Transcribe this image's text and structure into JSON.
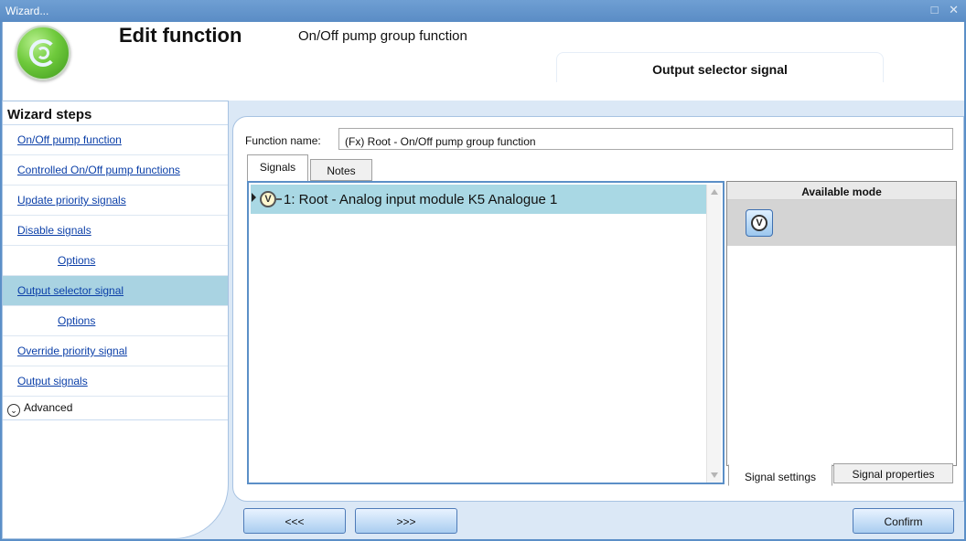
{
  "window": {
    "title": "Wizard...",
    "controls": "□ ✕"
  },
  "header": {
    "title": "Edit function",
    "subtitle": "On/Off pump group function",
    "current_step": "Output selector signal"
  },
  "sidebar": {
    "title": "Wizard steps",
    "items": [
      {
        "label": "On/Off pump function"
      },
      {
        "label": "Controlled On/Off pump functions"
      },
      {
        "label": "Update priority signals"
      },
      {
        "label": "Disable signals"
      },
      {
        "label": "Options"
      },
      {
        "label": "Output selector signal"
      },
      {
        "label": "Options"
      },
      {
        "label": "Override priority signal"
      },
      {
        "label": "Output signals"
      }
    ],
    "advanced_label": "Advanced"
  },
  "form": {
    "function_name_label": "Function name:",
    "function_name_value": "(Fx) Root - On/Off pump group function"
  },
  "tabs": {
    "signals": "Signals",
    "notes": "Notes"
  },
  "signals": [
    {
      "icon": "V",
      "label": "1: Root - Analog input module K5 Analogue 1"
    }
  ],
  "modes": {
    "header": "Available mode",
    "icon": "V",
    "tab_settings": "Signal settings",
    "tab_properties": "Signal properties"
  },
  "buttons": {
    "prev": "<<<",
    "next": ">>>",
    "confirm": "Confirm"
  },
  "colors": {
    "title_bar": "#5b8fc7",
    "active_step": "#a9d3e2",
    "selected_signal": "#a9d8e4",
    "link": "#0b3fa8"
  }
}
